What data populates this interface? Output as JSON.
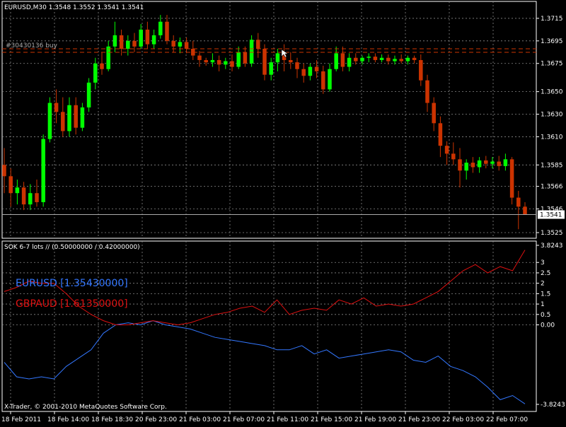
{
  "window": {
    "title": "EURUSD,M30  1.3548 1.3552 1.3541 1.3541",
    "copyright": "X-Trader, © 2001-2010 MetaQuotes Software Corp."
  },
  "colors": {
    "background": "#000000",
    "bull_candle": "#00ff00",
    "bear_candle": "#cc3300",
    "grid": "#888888",
    "eurusd_line": "#3377ff",
    "gbpaud_line": "#dd1111",
    "order_line": "#cc3300",
    "price_label_bg": "#ffffff"
  },
  "main_chart": {
    "symbol": "EURUSD",
    "timeframe": "M30",
    "order_label": "#30430136 buy",
    "order_level": 1.3688,
    "current_price": "1.3541",
    "price_ticks": [
      "1.3715",
      "1.3695",
      "1.3675",
      "1.3650",
      "1.3630",
      "1.3610",
      "1.3585",
      "1.3566",
      "1.3546",
      "1.3525"
    ]
  },
  "indicator": {
    "title": "SOK 6-7 lots // (0.50000000 / 0.42000000)",
    "legend": [
      {
        "name": "EURUSD [1.35430000]",
        "color": "#3377ff"
      },
      {
        "name": "GBPAUD [1.61350000]",
        "color": "#dd1111"
      }
    ],
    "ticks": [
      "3.8243",
      "3",
      "2.5",
      "2",
      "1.5",
      "1",
      "0.5",
      "0.00",
      "-3.8243"
    ]
  },
  "time_axis": [
    "18 Feb 2011",
    "18 Feb 14:00",
    "18 Feb 18:30",
    "20 Feb 23:00",
    "21 Feb 03:00",
    "21 Feb 07:00",
    "21 Feb 11:00",
    "21 Feb 15:00",
    "21 Feb 19:00",
    "21 Feb 23:00",
    "22 Feb 03:00",
    "22 Feb 07:00"
  ],
  "chart_data": [
    {
      "type": "candlestick",
      "title": "EURUSD,M30  1.3548 1.3552 1.3541 1.3541",
      "ylim": [
        1.352,
        1.373
      ],
      "grid": true,
      "x": [
        "18 Feb 2011",
        "18 Feb 14:00",
        "18 Feb 18:30",
        "20 Feb 23:00",
        "21 Feb 03:00",
        "21 Feb 07:00",
        "21 Feb 11:00",
        "21 Feb 15:00",
        "21 Feb 19:00",
        "21 Feb 23:00",
        "22 Feb 03:00",
        "22 Feb 07:00"
      ],
      "candles": [
        {
          "o": 1.3585,
          "h": 1.36,
          "l": 1.356,
          "c": 1.3575
        },
        {
          "o": 1.3575,
          "h": 1.3582,
          "l": 1.3548,
          "c": 1.356
        },
        {
          "o": 1.356,
          "h": 1.3572,
          "l": 1.355,
          "c": 1.3565
        },
        {
          "o": 1.3565,
          "h": 1.357,
          "l": 1.3545,
          "c": 1.355
        },
        {
          "o": 1.355,
          "h": 1.3568,
          "l": 1.3545,
          "c": 1.356
        },
        {
          "o": 1.356,
          "h": 1.3572,
          "l": 1.3548,
          "c": 1.3552
        },
        {
          "o": 1.3552,
          "h": 1.3612,
          "l": 1.3548,
          "c": 1.3608
        },
        {
          "o": 1.3608,
          "h": 1.3645,
          "l": 1.3605,
          "c": 1.364
        },
        {
          "o": 1.364,
          "h": 1.3652,
          "l": 1.3622,
          "c": 1.3632
        },
        {
          "o": 1.3632,
          "h": 1.3645,
          "l": 1.361,
          "c": 1.3615
        },
        {
          "o": 1.3615,
          "h": 1.3645,
          "l": 1.361,
          "c": 1.3638
        },
        {
          "o": 1.3638,
          "h": 1.3645,
          "l": 1.3612,
          "c": 1.3618
        },
        {
          "o": 1.3618,
          "h": 1.364,
          "l": 1.3615,
          "c": 1.3636
        },
        {
          "o": 1.3636,
          "h": 1.3662,
          "l": 1.3632,
          "c": 1.3658
        },
        {
          "o": 1.3658,
          "h": 1.368,
          "l": 1.3652,
          "c": 1.3675
        },
        {
          "o": 1.3675,
          "h": 1.3685,
          "l": 1.3665,
          "c": 1.367
        },
        {
          "o": 1.367,
          "h": 1.3695,
          "l": 1.3668,
          "c": 1.369
        },
        {
          "o": 1.369,
          "h": 1.3712,
          "l": 1.3685,
          "c": 1.37
        },
        {
          "o": 1.37,
          "h": 1.3705,
          "l": 1.3682,
          "c": 1.3688
        },
        {
          "o": 1.3688,
          "h": 1.37,
          "l": 1.3682,
          "c": 1.3695
        },
        {
          "o": 1.3695,
          "h": 1.3702,
          "l": 1.3685,
          "c": 1.369
        },
        {
          "o": 1.369,
          "h": 1.371,
          "l": 1.3688,
          "c": 1.3705
        },
        {
          "o": 1.3705,
          "h": 1.3712,
          "l": 1.3688,
          "c": 1.3692
        },
        {
          "o": 1.3692,
          "h": 1.3705,
          "l": 1.3688,
          "c": 1.37
        },
        {
          "o": 1.37,
          "h": 1.3718,
          "l": 1.3697,
          "c": 1.3712
        },
        {
          "o": 1.3712,
          "h": 1.3718,
          "l": 1.3692,
          "c": 1.3695
        },
        {
          "o": 1.3695,
          "h": 1.37,
          "l": 1.3685,
          "c": 1.369
        },
        {
          "o": 1.369,
          "h": 1.3698,
          "l": 1.3684,
          "c": 1.3694
        },
        {
          "o": 1.3694,
          "h": 1.3698,
          "l": 1.3684,
          "c": 1.3688
        },
        {
          "o": 1.3688,
          "h": 1.3695,
          "l": 1.3678,
          "c": 1.3682
        },
        {
          "o": 1.3682,
          "h": 1.3686,
          "l": 1.3672,
          "c": 1.3678
        },
        {
          "o": 1.3678,
          "h": 1.368,
          "l": 1.3673,
          "c": 1.3676
        },
        {
          "o": 1.3676,
          "h": 1.3684,
          "l": 1.3672,
          "c": 1.3678
        },
        {
          "o": 1.3678,
          "h": 1.3682,
          "l": 1.3668,
          "c": 1.3674
        },
        {
          "o": 1.3674,
          "h": 1.368,
          "l": 1.367,
          "c": 1.3677
        },
        {
          "o": 1.3677,
          "h": 1.3683,
          "l": 1.3668,
          "c": 1.3672
        },
        {
          "o": 1.3672,
          "h": 1.369,
          "l": 1.367,
          "c": 1.3685
        },
        {
          "o": 1.3685,
          "h": 1.369,
          "l": 1.3672,
          "c": 1.3675
        },
        {
          "o": 1.3675,
          "h": 1.37,
          "l": 1.3672,
          "c": 1.3696
        },
        {
          "o": 1.3696,
          "h": 1.3702,
          "l": 1.368,
          "c": 1.3688
        },
        {
          "o": 1.3688,
          "h": 1.3692,
          "l": 1.366,
          "c": 1.3665
        },
        {
          "o": 1.3665,
          "h": 1.368,
          "l": 1.366,
          "c": 1.3676
        },
        {
          "o": 1.3676,
          "h": 1.3688,
          "l": 1.3668,
          "c": 1.3684
        },
        {
          "o": 1.3684,
          "h": 1.3692,
          "l": 1.3668,
          "c": 1.3678
        },
        {
          "o": 1.3678,
          "h": 1.3685,
          "l": 1.367,
          "c": 1.3676
        },
        {
          "o": 1.3676,
          "h": 1.368,
          "l": 1.3662,
          "c": 1.367
        },
        {
          "o": 1.367,
          "h": 1.3675,
          "l": 1.3658,
          "c": 1.3664
        },
        {
          "o": 1.3664,
          "h": 1.3675,
          "l": 1.366,
          "c": 1.3672
        },
        {
          "o": 1.3672,
          "h": 1.3678,
          "l": 1.3662,
          "c": 1.3668
        },
        {
          "o": 1.3668,
          "h": 1.3673,
          "l": 1.3648,
          "c": 1.3652
        },
        {
          "o": 1.3652,
          "h": 1.3675,
          "l": 1.365,
          "c": 1.367
        },
        {
          "o": 1.367,
          "h": 1.369,
          "l": 1.3668,
          "c": 1.3684
        },
        {
          "o": 1.3684,
          "h": 1.369,
          "l": 1.3668,
          "c": 1.3672
        },
        {
          "o": 1.3672,
          "h": 1.3684,
          "l": 1.3668,
          "c": 1.368
        },
        {
          "o": 1.368,
          "h": 1.3684,
          "l": 1.3674,
          "c": 1.3677
        },
        {
          "o": 1.3677,
          "h": 1.3682,
          "l": 1.3674,
          "c": 1.368
        },
        {
          "o": 1.368,
          "h": 1.3684,
          "l": 1.3676,
          "c": 1.3681
        },
        {
          "o": 1.3681,
          "h": 1.3684,
          "l": 1.3676,
          "c": 1.3678
        },
        {
          "o": 1.3678,
          "h": 1.3683,
          "l": 1.3676,
          "c": 1.368
        },
        {
          "o": 1.368,
          "h": 1.3683,
          "l": 1.3674,
          "c": 1.3677
        },
        {
          "o": 1.3677,
          "h": 1.3682,
          "l": 1.3674,
          "c": 1.3679
        },
        {
          "o": 1.3679,
          "h": 1.3683,
          "l": 1.3675,
          "c": 1.3677
        },
        {
          "o": 1.3677,
          "h": 1.3682,
          "l": 1.3674,
          "c": 1.368
        },
        {
          "o": 1.368,
          "h": 1.3682,
          "l": 1.3675,
          "c": 1.3678
        },
        {
          "o": 1.3678,
          "h": 1.3683,
          "l": 1.3655,
          "c": 1.366
        },
        {
          "o": 1.366,
          "h": 1.3665,
          "l": 1.3632,
          "c": 1.364
        },
        {
          "o": 1.364,
          "h": 1.3645,
          "l": 1.3615,
          "c": 1.3622
        },
        {
          "o": 1.3622,
          "h": 1.3628,
          "l": 1.3592,
          "c": 1.3602
        },
        {
          "o": 1.3602,
          "h": 1.3606,
          "l": 1.3585,
          "c": 1.3595
        },
        {
          "o": 1.3595,
          "h": 1.3605,
          "l": 1.3585,
          "c": 1.359
        },
        {
          "o": 1.359,
          "h": 1.36,
          "l": 1.3565,
          "c": 1.358
        },
        {
          "o": 1.358,
          "h": 1.359,
          "l": 1.3572,
          "c": 1.3587
        },
        {
          "o": 1.3587,
          "h": 1.3592,
          "l": 1.3578,
          "c": 1.3583
        },
        {
          "o": 1.3583,
          "h": 1.3592,
          "l": 1.3578,
          "c": 1.3589
        },
        {
          "o": 1.3589,
          "h": 1.3593,
          "l": 1.3582,
          "c": 1.3586
        },
        {
          "o": 1.3586,
          "h": 1.3592,
          "l": 1.3582,
          "c": 1.3588
        },
        {
          "o": 1.3588,
          "h": 1.3593,
          "l": 1.358,
          "c": 1.3584
        },
        {
          "o": 1.3584,
          "h": 1.3595,
          "l": 1.358,
          "c": 1.359
        },
        {
          "o": 1.359,
          "h": 1.3592,
          "l": 1.355,
          "c": 1.3556
        },
        {
          "o": 1.3556,
          "h": 1.3562,
          "l": 1.3528,
          "c": 1.3548
        },
        {
          "o": 1.3548,
          "h": 1.3552,
          "l": 1.3541,
          "c": 1.3541
        }
      ]
    },
    {
      "type": "line",
      "title": "SOK 6-7 lots // (0.50000000 / 0.42000000)",
      "ylim": [
        -3.8243,
        3.8243
      ],
      "grid": true,
      "x": [
        "18 Feb 2011",
        "18 Feb 14:00",
        "18 Feb 18:30",
        "20 Feb 23:00",
        "21 Feb 03:00",
        "21 Feb 07:00",
        "21 Feb 11:00",
        "21 Feb 15:00",
        "21 Feb 19:00",
        "21 Feb 23:00",
        "22 Feb 03:00",
        "22 Feb 07:00"
      ],
      "series": [
        {
          "name": "EURUSD [1.35430000]",
          "values": [
            -1.8,
            -2.5,
            -2.6,
            -2.5,
            -2.6,
            -2.0,
            -1.6,
            -1.2,
            -0.4,
            0.0,
            0.1,
            0.0,
            0.2,
            0.0,
            -0.1,
            -0.2,
            -0.4,
            -0.6,
            -0.7,
            -0.8,
            -0.9,
            -1.0,
            -1.2,
            -1.2,
            -1.0,
            -1.4,
            -1.2,
            -1.6,
            -1.5,
            -1.4,
            -1.3,
            -1.2,
            -1.3,
            -1.7,
            -1.8,
            -1.5,
            -2.0,
            -2.2,
            -2.5,
            -3.0,
            -3.6,
            -3.4,
            -3.8
          ]
        },
        {
          "name": "GBPAUD [1.61350000]",
          "values": [
            1.6,
            1.8,
            2.1,
            2.0,
            2.0,
            1.5,
            0.9,
            0.5,
            0.2,
            0.0,
            0.0,
            0.1,
            0.2,
            0.1,
            0.0,
            0.1,
            0.3,
            0.5,
            0.6,
            0.8,
            0.9,
            0.6,
            1.2,
            0.5,
            0.7,
            0.8,
            0.7,
            1.2,
            1.0,
            1.3,
            0.9,
            1.0,
            0.9,
            1.0,
            1.3,
            1.6,
            2.1,
            2.6,
            2.9,
            2.5,
            2.8,
            2.6,
            3.6
          ]
        }
      ]
    }
  ]
}
